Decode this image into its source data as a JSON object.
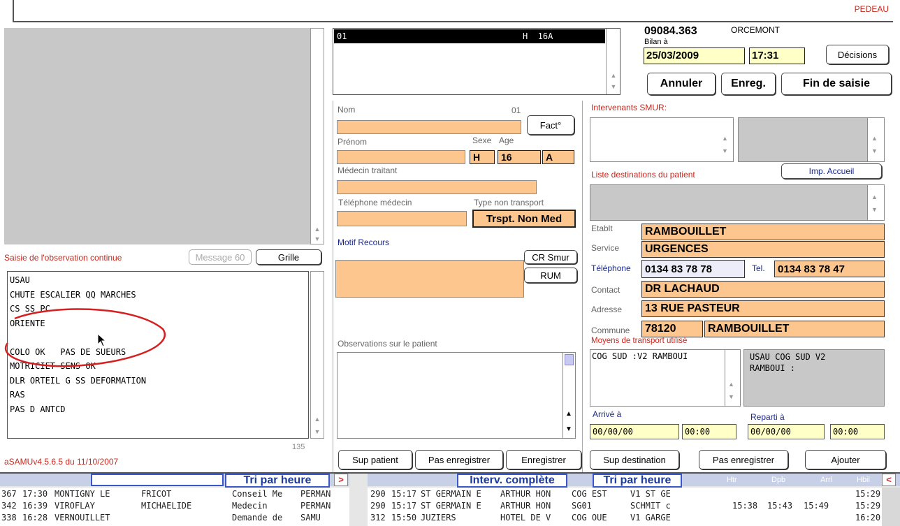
{
  "header": {
    "user": "PEDEAU"
  },
  "dossier": {
    "line_id": "01",
    "line_sex_age": "H  16A",
    "number": "09084.363",
    "commune": "ORCEMONT",
    "bilan_label": "Bilan à",
    "date": "25/03/2009",
    "time": "17:31",
    "decisions_label": "Décisions",
    "annuler_label": "Annuler",
    "enreg_label": "Enreg.",
    "fin_label": "Fin de saisie"
  },
  "patient": {
    "nom_label": "Nom",
    "nom_index": "01",
    "fact_label": "Fact°",
    "prenom_label": "Prénom",
    "sexe_label": "Sexe",
    "age_label": "Age",
    "sexe_value": "H",
    "age_value": "16",
    "age_unit": "A",
    "medecin_label": "Médecin traitant",
    "tel_medecin_label": "Téléphone médecin",
    "type_non_transport_label": "Type non transport",
    "type_non_transport_value": "Trspt. Non Med",
    "motif_label": "Motif Recours",
    "cr_smur_label": "CR Smur",
    "rum_label": "RUM",
    "observations_label": "Observations sur le patient",
    "sup_patient_label": "Sup patient",
    "pas_enregistrer_label": "Pas enregistrer",
    "enregistrer_label": "Enregistrer"
  },
  "observation": {
    "title": "Saisie de l'observation continue",
    "message_label": "Message 60",
    "grille_label": "Grille",
    "lines": [
      "USAU",
      "CHUTE ESCALIER QQ MARCHES",
      "CS SS PC",
      "ORIENTE",
      "",
      "COLO OK   PAS DE SUEURS",
      "MOTRICIET SENS OK",
      "DLR ORTEIL G SS DEFORMATION",
      "RAS",
      "PAS D ANTCD"
    ],
    "char_count": "135",
    "version": "aSAMUv4.5.6.5 du 11/10/2007"
  },
  "destination": {
    "intervenants_label": "Intervenants SMUR:",
    "liste_label": "Liste destinations du patient",
    "imp_accueil_label": "Imp. Accueil",
    "etablt_label": "Etablt",
    "etablt_value": "RAMBOUILLET",
    "service_label": "Service",
    "service_value": "URGENCES",
    "telephone_label": "Téléphone",
    "telephone_value": "0134 83 78 78",
    "tel_label": "Tel.",
    "tel_value": "0134 83 78 47",
    "contact_label": "Contact",
    "contact_value": "DR LACHAUD",
    "adresse_label": "Adresse",
    "adresse_value": "13 RUE PASTEUR",
    "commune_label": "Commune",
    "cp_value": "78120",
    "commune_value": "RAMBOUILLET",
    "moyens_label": "Moyens de transport utilisé",
    "moyen_left": "COG SUD :V2 RAMBOUI",
    "moyen_right": "USAU COG SUD V2\nRAMBOUI :",
    "arrive_label": "Arrivé à",
    "arrive_date": "00/00/00",
    "arrive_time": "00:00",
    "reparti_label": "Reparti à",
    "reparti_date": "00/00/00",
    "reparti_time": "00:00",
    "sup_destination_label": "Sup destination",
    "pas_enregistrer_label": "Pas enregistrer",
    "ajouter_label": "Ajouter"
  },
  "bottom": {
    "left_header": "Tri par heure",
    "left_arrow": ">",
    "interv_header": "Interv. complète",
    "right_header": "Tri par heure",
    "col_htr": "Htr",
    "col_dpb": "Dpb",
    "col_arrl": "Arrl",
    "col_hbil": "Hbil",
    "right_arrow": "<",
    "left_rows": [
      {
        "num": "367",
        "time": "17:30",
        "city": "MONTIGNY LE",
        "name": "FRICOT",
        "motif": "Conseil Me",
        "type": "PERMAN"
      },
      {
        "num": "342",
        "time": "16:39",
        "city": "VIROFLAY",
        "name": "MICHAELIDE",
        "motif": "Medecin",
        "type": "PERMAN"
      },
      {
        "num": "338",
        "time": "16:28",
        "city": "VERNOUILLET",
        "name": "",
        "motif": "Demande de",
        "type": "SAMU"
      }
    ],
    "right_rows": [
      {
        "num": "290",
        "time": "15:17",
        "city": "ST GERMAIN E",
        "name": "ARTHUR HON",
        "unit": "COG EST",
        "vehicle": "V1 ST GE",
        "htr": "",
        "dpb": "",
        "arr": "",
        "hbil": "15:29"
      },
      {
        "num": "290",
        "time": "15:17",
        "city": "ST GERMAIN E",
        "name": "ARTHUR HON",
        "unit": "SG01",
        "vehicle": "SCHMIT c",
        "htr": "15:38",
        "dpb": "15:43",
        "arr": "15:49",
        "hbil": "15:29"
      },
      {
        "num": "312",
        "time": "15:50",
        "city": "JUZIERS",
        "name": "HOTEL DE V",
        "unit": "COG OUE",
        "vehicle": "V1 GARGE",
        "htr": "",
        "dpb": "",
        "arr": "",
        "hbil": "16:20"
      }
    ]
  },
  "colors": {
    "orange_field": "#fcc68e",
    "yellow_field": "#ffffc8",
    "label_red": "#c8281e",
    "header_blue": "#1a3aa0"
  }
}
